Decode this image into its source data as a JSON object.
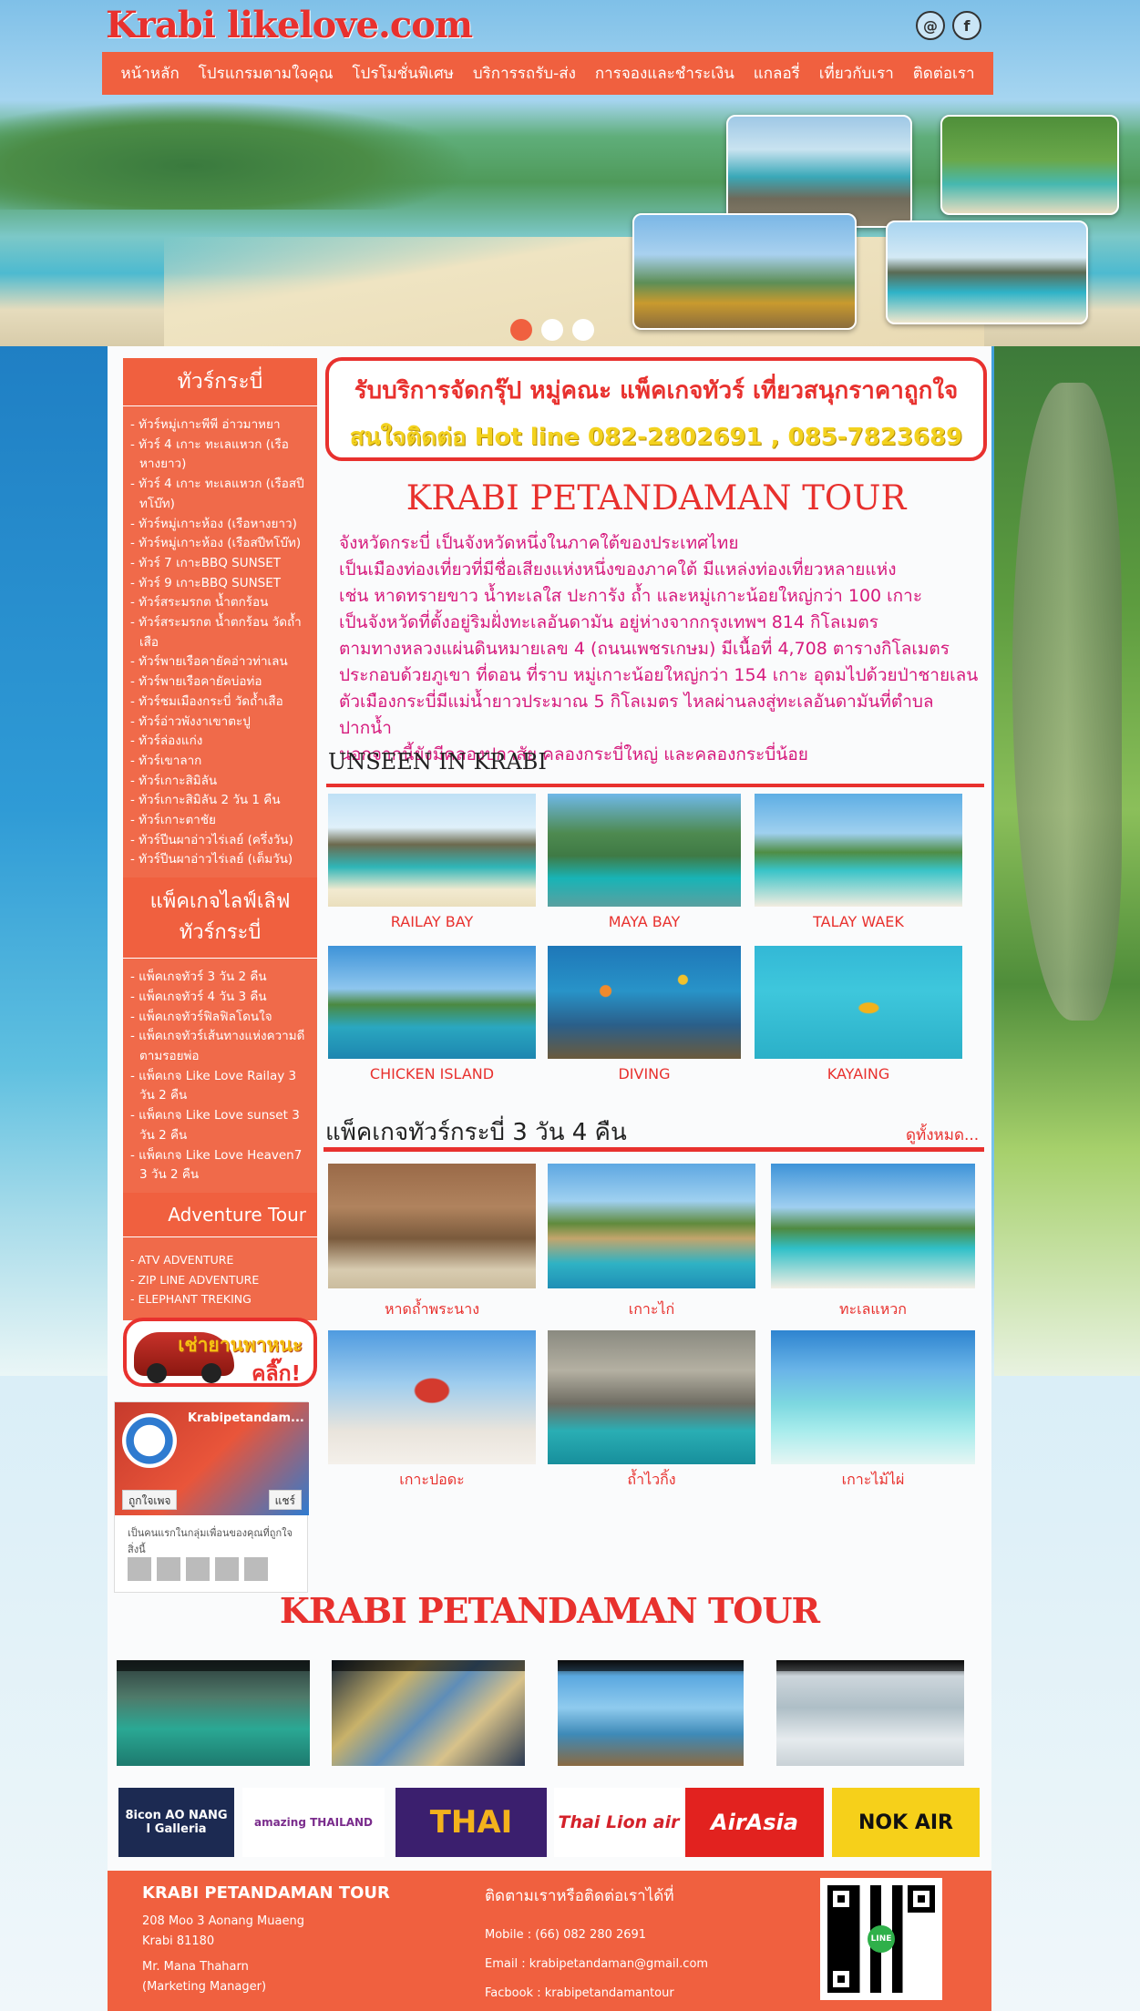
{
  "header": {
    "logo": "Krabi likelove.com",
    "social": [
      "@",
      "f"
    ],
    "nav": [
      "หน้าหลัก",
      "โปรแกรมตามใจคุณ",
      "โปรโมชั่นพิเศษ",
      "บริการรถรับ-ส่ง",
      "การจองและชำระเงิน",
      "แกลอรี่",
      "เที่ยวกับเรา",
      "ติดต่อเรา"
    ]
  },
  "sidebar": {
    "tours_heading": "ทัวร์กระบี่",
    "tours": [
      "- ทัวร์หมู่เกาะพีพี อ่าวมาหยา",
      "- ทัวร์ 4 เกาะ ทะเลแหวก (เรือหางยาว)",
      "- ทัวร์ 4 เกาะ ทะเลแหวก (เรือสปีทโบ๊ท)",
      "- ทัวร์หมู่เกาะห้อง (เรือหางยาว)",
      "- ทัวร์หมู่เกาะห้อง (เรือสปีทโบ๊ท)",
      "- ทัวร์ 7 เกาะBBQ SUNSET",
      "- ทัวร์ 9 เกาะBBQ SUNSET",
      "- ทัวร์สระมรกต น้ำตกร้อน",
      "- ทัวร์สระมรกต น้ำตกร้อน วัดถ้ำเสือ",
      "- ทัวร์พายเรือคายัคอ่าวท่าเลน",
      "- ทัวร์พายเรือคายัคบ่อท่อ",
      "- ทัวร์ชมเมืองกระบี่ วัดถ้ำเสือ",
      "- ทัวร์อ่าวพังงาเขาตะปู",
      "- ทัวร์ล่องแก่ง",
      "- ทัวร์เขาลาก",
      "- ทัวร์เกาะสิมิลัน",
      "- ทัวร์เกาะสิมิลัน 2 วัน 1 คืน",
      "- ทัวร์เกาะตาชัย",
      "- ทัวร์ปีนผาอ่าวไร่เลย์ (ครึ่งวัน)",
      "- ทัวร์ปีนผาอ่าวไร่เลย์ (เต็มวัน)"
    ],
    "packages_heading": "แพ็คเกจไลฟ์เลิฟ ทัวร์กระบี่",
    "packages": [
      "- แพ็คเกจทัวร์ 3 วัน 2 คืน",
      "- แพ็คเกจทัวร์ 4 วัน 3 คืน",
      "- แพ็คเกจทัวร์ฟิลฟิลโดนใจ",
      "- แพ็คเกจทัวร์เส้นทางแห่งความดี ตามรอยพ่อ",
      "- แพ็คเกจ Like Love Railay 3 วัน 2 คืน",
      "- แพ็คเกจ Like Love sunset 3 วัน 2 คืน",
      "- แพ็คเกจ Like Love Heaven7 3 วัน 2 คืน"
    ],
    "adventure_heading": "Adventure Tour",
    "adventure": [
      "- ATV ADVENTURE",
      "- ZIP LINE ADVENTURE",
      "- ELEPHANT TREKING"
    ],
    "car_banner": {
      "line1": "เช่ายานพาหนะ",
      "line2": "คลิ๊ก!"
    },
    "facebook": {
      "page_name": "Krabipetandam...",
      "like": "ถูกใจเพจ",
      "share": "แชร์",
      "friends_text": "เป็นคนแรกในกลุ่มเพื่อนของคุณที่ถูกใจสิ่งนี้"
    }
  },
  "promo": {
    "line1": "รับบริการจัดกรุ๊ป หมู่คณะ แพ็คเกจทัวร์ เที่ยวสนุกราคาถูกใจ",
    "line2": "สนใจติดต่อ Hot line 082-2802691 , 085-7823689"
  },
  "main": {
    "title": "KRABI PETANDAMAN TOUR",
    "intro": [
      "จังหวัดกระบี่ เป็นจังหวัดหนึ่งในภาคใต้ของประเทศไทย",
      "เป็นเมืองท่องเที่ยวที่มีชื่อเสียงแห่งหนึ่งของภาคใต้ มีแหล่งท่องเที่ยวหลายแห่ง",
      "เช่น หาดทรายขาว น้ำทะเลใส ปะการัง ถ้ำ และหมู่เกาะน้อยใหญ่กว่า 100 เกาะ",
      "เป็นจังหวัดที่ตั้งอยู่ริมฝั่งทะเลอันดามัน อยู่ห่างจากกรุงเทพฯ 814 กิโลเมตร",
      "ตามทางหลวงแผ่นดินหมายเลข 4 (ถนนเพชรเกษม) มีเนื้อที่ 4,708 ตารางกิโลเมตร",
      "ประกอบด้วยภูเขา ที่ดอน ที่ราบ หมู่เกาะน้อยใหญ่กว่า 154 เกาะ อุดมไปด้วยป่าชายเลน",
      "ตัวเมืองกระบี่มีแม่น้ำยาวประมาณ 5 กิโลเมตร ไหลผ่านลงสู่ทะเลอันดามันที่ตำบลปากน้ำ",
      "นอกจากนี้ยังมีคลองปกาสัย คลองกระบี่ใหญ่ และคลองกระบี่น้อย"
    ],
    "unseen_heading": "UNSEEN IN KRABI",
    "unseen": [
      "RAILAY BAY",
      "MAYA BAY",
      "TALAY WAEK",
      "CHICKEN ISLAND",
      "DIVING",
      "KAYAING"
    ],
    "package_heading": "แพ็คเกจทัวร์กระบี่ 3 วัน 4 คืน",
    "see_all": "ดูทั้งหมด...",
    "package_places": [
      "หาดถ้ำพระนาง",
      "เกาะไก่",
      "ทะเลแหวก",
      "เกาะปอดะ",
      "ถ้ำไวกิ้ง",
      "เกาะไม้ไผ่"
    ],
    "video_heading": "KRABI PETANDAMAN TOUR"
  },
  "partners": [
    "8icon AO NANG I Galleria",
    "amazing THAILAND",
    "THAI",
    "Thai Lion air",
    "AirAsia",
    "NOK AIR"
  ],
  "footer": {
    "company": "KRABI PETANDAMAN TOUR",
    "address1": "208 Moo 3 Aonang Muaeng",
    "address2": "Krabi 81180",
    "contact_name": "Mr. Mana Thaharn",
    "contact_role": "(Marketing Manager)",
    "follow": "ติดตามเราหรือติดต่อเราได้ที่",
    "mobile": "Mobile : (66) 082 280 2691",
    "email": "Email : krabipetandaman@gmail.com",
    "facebook": "Facbook : krabipetandamantour",
    "qr_label": "LINE"
  },
  "colors": {
    "accent": "#f0603f",
    "red": "#e8312e",
    "pink": "#d6197c",
    "yellow": "#f3d21f"
  }
}
